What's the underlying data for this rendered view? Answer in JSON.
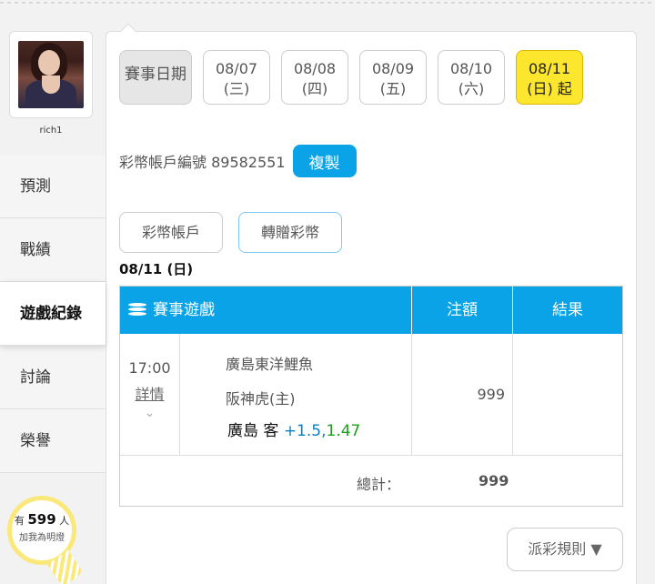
{
  "sidebar": {
    "username": "rich1",
    "items": [
      {
        "label": "預測"
      },
      {
        "label": "戰績"
      },
      {
        "label": "遊戲紀錄"
      },
      {
        "label": "討論"
      },
      {
        "label": "榮譽"
      }
    ],
    "bulb": {
      "prefix": "有",
      "count": "599",
      "suffix": "人",
      "text": "加我為明燈"
    }
  },
  "dates": {
    "label": "賽事日期",
    "tabs": [
      {
        "date": "08/07",
        "day": "(三)"
      },
      {
        "date": "08/08",
        "day": "(四)"
      },
      {
        "date": "08/09",
        "day": "(五)"
      },
      {
        "date": "08/10",
        "day": "(六)"
      },
      {
        "date": "08/11",
        "day": "(日) 起"
      }
    ]
  },
  "account": {
    "text": "彩幣帳戶編號 89582551",
    "copy_label": "複製"
  },
  "buttons": {
    "wallet": "彩幣帳戶",
    "transfer": "轉贈彩幣"
  },
  "date_heading": "08/11 (日)",
  "table": {
    "headers": {
      "game": "賽事遊戲",
      "stake": "注額",
      "result": "結果"
    },
    "row": {
      "time": "17:00",
      "detail": "詳情",
      "team_away": "廣島東洋鯉魚",
      "team_home": "阪神虎(主)",
      "pick_team": "廣島 客",
      "pick_line": "+1.5,",
      "pick_odds": "1.47",
      "stake": "999",
      "result": ""
    },
    "total_label": "總計：",
    "total_value": "999"
  },
  "rules_label": "派彩規則 ▼",
  "colors": {
    "accent": "#0aa3e8",
    "active_date": "#fce62e",
    "line": "#0a7fc0",
    "odds": "#1aa01a"
  }
}
